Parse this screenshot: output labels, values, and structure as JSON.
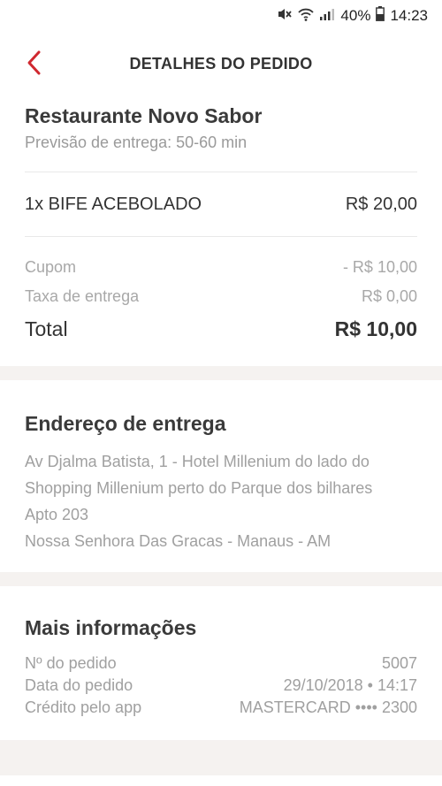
{
  "status_bar": {
    "battery": "40%",
    "time": "14:23",
    "icons": [
      "mute-icon",
      "wifi-icon",
      "signal-icon",
      "battery-icon"
    ]
  },
  "header": {
    "title": "DETALHES DO PEDIDO",
    "back_icon": "chevron-left-icon"
  },
  "restaurant": {
    "name": "Restaurante Novo Sabor",
    "eta": "Previsão de entrega: 50-60 min"
  },
  "items": [
    {
      "label": "1x BIFE ACEBOLADO",
      "price": "R$ 20,00"
    }
  ],
  "summary": {
    "coupon_label": "Cupom",
    "coupon_value": "- R$ 10,00",
    "fee_label": "Taxa de entrega",
    "fee_value": "R$ 0,00",
    "total_label": "Total",
    "total_value": "R$ 10,00"
  },
  "address": {
    "title": "Endereço de entrega",
    "lines": [
      "Av Djalma Batista, 1 - Hotel Millenium do lado do",
      "Shopping Millenium perto do Parque dos bilhares",
      "Apto 203",
      "Nossa Senhora Das Gracas - Manaus - AM"
    ]
  },
  "more_info": {
    "title": "Mais informações",
    "order_number_label": "Nº do pedido",
    "order_number_value": "5007",
    "order_date_label": "Data do pedido",
    "order_date_value": "29/10/2018 • 14:17",
    "payment_label": "Crédito pelo app",
    "payment_value": "MASTERCARD •••• 2300"
  },
  "colors": {
    "accent": "#d0282f",
    "separator": "#f5f2f0",
    "muted_text": "#a0a0a0"
  }
}
